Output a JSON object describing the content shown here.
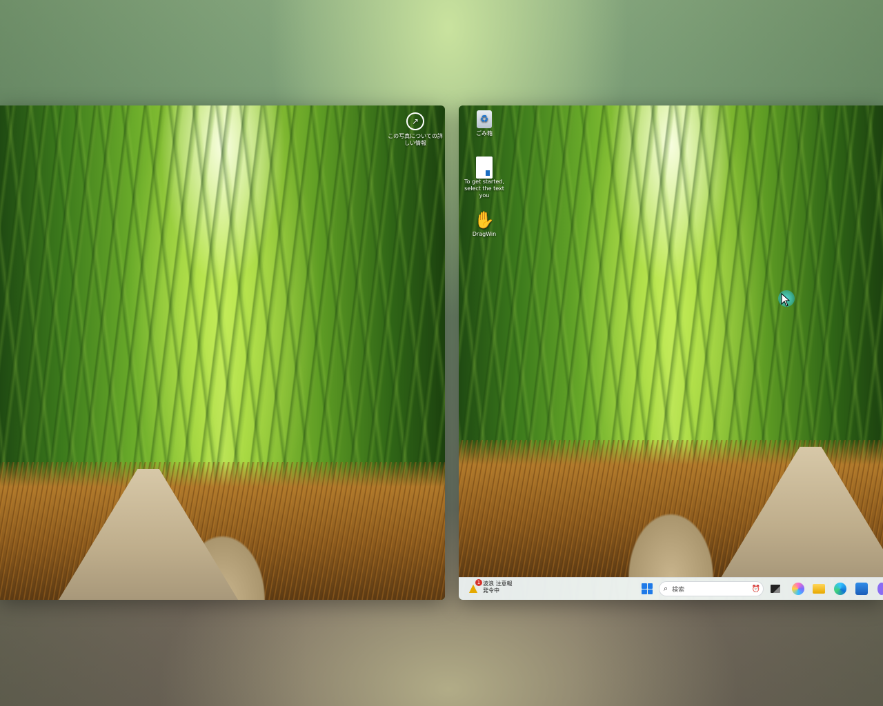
{
  "left_screen": {
    "info_widget": {
      "icon": "info-circle-icon",
      "text": "この写真についての詳しい情報"
    }
  },
  "right_screen": {
    "desktop_icons": [
      {
        "label": "ごみ箱",
        "icon": "recycle-bin-icon"
      },
      {
        "label": "To get started, select the text you",
        "icon": "document-icon"
      },
      {
        "label": "DragWin",
        "icon": "dragwin-hand-icon"
      }
    ],
    "taskbar": {
      "weather": {
        "icon": "weather-alert-icon",
        "badge": "1",
        "line1": "波浪 注意報",
        "line2": "発令中"
      },
      "start_icon": "windows-start-icon",
      "search": {
        "placeholder": "検索",
        "icon": "search-icon"
      },
      "pinned": [
        {
          "name": "task-view-icon"
        },
        {
          "name": "copilot-icon"
        },
        {
          "name": "file-explorer-icon"
        },
        {
          "name": "edge-browser-icon"
        },
        {
          "name": "microsoft-store-icon"
        },
        {
          "name": "extra-app-icon"
        }
      ]
    }
  },
  "colors": {
    "taskbar_bg": "#eef1f4",
    "start_blue": "#1f7ae8",
    "cursor_highlight": "#40c8d8"
  }
}
